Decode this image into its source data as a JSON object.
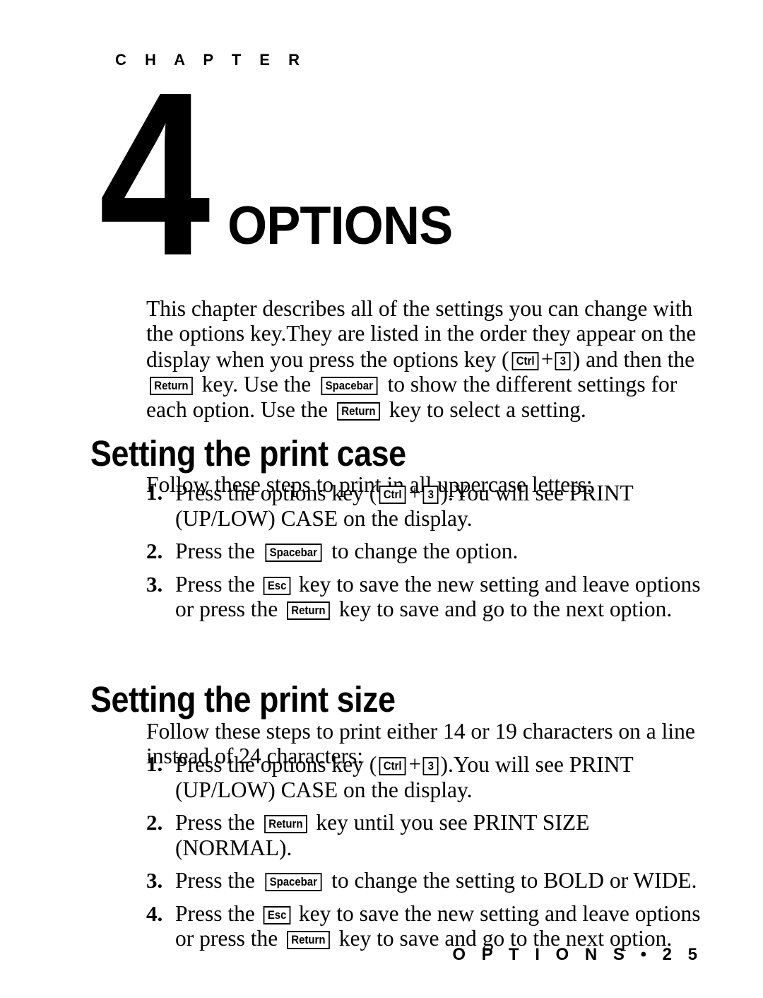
{
  "chapter": {
    "label": "C H A P T E R",
    "number": "4",
    "title": "OPTIONS"
  },
  "intro": {
    "tokens": [
      {
        "t": "text",
        "v": "This chapter describes all of the settings you can change with the options key.They are listed in the order they appear on the display when you press the options key ("
      },
      {
        "t": "key",
        "v": "Ctrl"
      },
      {
        "t": "plus",
        "v": "+"
      },
      {
        "t": "key",
        "v": "3"
      },
      {
        "t": "text",
        "v": ") and then the "
      },
      {
        "t": "key",
        "v": "Return"
      },
      {
        "t": "text",
        "v": " key. Use the "
      },
      {
        "t": "key",
        "v": "Spacebar"
      },
      {
        "t": "text",
        "v": " to show the different settings for each option. Use the "
      },
      {
        "t": "key",
        "v": "Return"
      },
      {
        "t": "text",
        "v": " key to select a setting."
      }
    ]
  },
  "sections": [
    {
      "heading": "Setting the print case",
      "lead": {
        "tokens": [
          {
            "t": "text",
            "v": "Follow these steps to print in all uppercase letters:"
          }
        ]
      },
      "steps": [
        {
          "num": "1.",
          "tokens": [
            {
              "t": "text",
              "v": "Press the options key ("
            },
            {
              "t": "key",
              "v": "Ctrl"
            },
            {
              "t": "plus",
              "v": "+"
            },
            {
              "t": "key",
              "v": "3"
            },
            {
              "t": "text",
              "v": ").You will see PRINT (UP/LOW) CASE on the display."
            }
          ]
        },
        {
          "num": "2.",
          "tokens": [
            {
              "t": "text",
              "v": "Press the "
            },
            {
              "t": "key",
              "v": "Spacebar"
            },
            {
              "t": "text",
              "v": " to change the option."
            }
          ]
        },
        {
          "num": "3.",
          "tokens": [
            {
              "t": "text",
              "v": "Press the "
            },
            {
              "t": "key",
              "v": "Esc"
            },
            {
              "t": "text",
              "v": " key to save the new setting and leave options or press the "
            },
            {
              "t": "key",
              "v": "Return"
            },
            {
              "t": "text",
              "v": " key to save and go to the next option."
            }
          ]
        }
      ]
    },
    {
      "heading": "Setting the print size",
      "lead": {
        "tokens": [
          {
            "t": "text",
            "v": "Follow these steps to print either 14 or 19 characters on a line instead of 24 characters:"
          }
        ]
      },
      "steps": [
        {
          "num": "1.",
          "tokens": [
            {
              "t": "text",
              "v": "Press the options key ("
            },
            {
              "t": "key",
              "v": "Ctrl"
            },
            {
              "t": "plus",
              "v": "+"
            },
            {
              "t": "key",
              "v": "3"
            },
            {
              "t": "text",
              "v": ").You will see PRINT (UP/LOW) CASE on the display."
            }
          ]
        },
        {
          "num": "2.",
          "tokens": [
            {
              "t": "text",
              "v": "Press the "
            },
            {
              "t": "key",
              "v": "Return"
            },
            {
              "t": "text",
              "v": " key until you see PRINT SIZE (NORMAL)."
            }
          ]
        },
        {
          "num": "3.",
          "tokens": [
            {
              "t": "text",
              "v": "Press the "
            },
            {
              "t": "key",
              "v": "Spacebar"
            },
            {
              "t": "text",
              "v": " to change the setting to BOLD or WIDE."
            }
          ]
        },
        {
          "num": "4.",
          "tokens": [
            {
              "t": "text",
              "v": "Press the "
            },
            {
              "t": "key",
              "v": "Esc"
            },
            {
              "t": "text",
              "v": " key to save the new setting and leave options or press the "
            },
            {
              "t": "key",
              "v": "Return"
            },
            {
              "t": "text",
              "v": " key to save and go to the next option."
            }
          ]
        }
      ]
    }
  ],
  "footer": {
    "text": "O P T I O N S  •  2 5"
  }
}
